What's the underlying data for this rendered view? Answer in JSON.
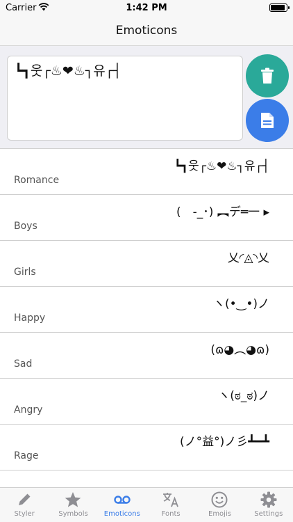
{
  "status": {
    "carrier": "Carrier",
    "time": "1:42 PM"
  },
  "nav": {
    "title": "Emoticons"
  },
  "editor": {
    "text": "┗┓웃┌♨❤♨┐유┌┤"
  },
  "rows": [
    {
      "emoticon": "┗┓웃┌♨❤♨┐유┌┤",
      "category": "Romance"
    },
    {
      "emoticon": "(　-_･) ︻デ═一 ▸",
      "category": "Boys"
    },
    {
      "emoticon": "乂◜◬◝乂",
      "category": "Girls"
    },
    {
      "emoticon": "ヽ(•‿•)ノ",
      "category": "Happy"
    },
    {
      "emoticon": "(ɷ◕︵◕ɷ)",
      "category": "Sad"
    },
    {
      "emoticon": "ヽ(ಠ_ಠ)ノ",
      "category": "Angry"
    },
    {
      "emoticon": "(ノ°益°)ノ彡┻━┻",
      "category": "Rage"
    }
  ],
  "tabs": [
    {
      "label": "Styler",
      "icon": "pencil-icon"
    },
    {
      "label": "Symbols",
      "icon": "star-icon"
    },
    {
      "label": "Emoticons",
      "icon": "voicemail-icon",
      "active": true
    },
    {
      "label": "Fonts",
      "icon": "translate-icon"
    },
    {
      "label": "Emojis",
      "icon": "smiley-icon"
    },
    {
      "label": "Settings",
      "icon": "gear-icon"
    }
  ],
  "colors": {
    "accent": "#3b7de8",
    "delete": "#2aa999",
    "inactive_tab": "#8e8e93"
  }
}
